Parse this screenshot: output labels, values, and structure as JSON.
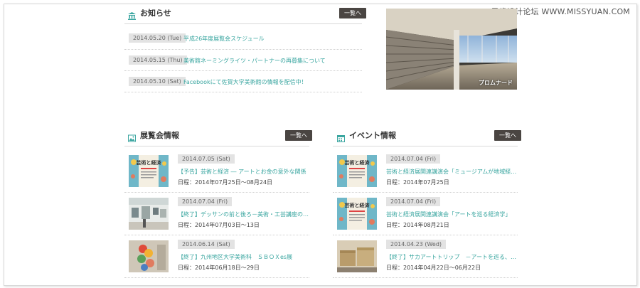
{
  "watermark": "思缘设计论坛 WWW.MISSYUAN.COM",
  "news": {
    "title": "お知らせ",
    "more_label": "一覧へ",
    "items": [
      {
        "date": "2014.05.20 (Tue)",
        "text": "平成26年度展覧会スケジュール"
      },
      {
        "date": "2014.05.15 (Thu)",
        "text": "美術館ネーミングライツ・パートナーの再募集について"
      },
      {
        "date": "2014.05.10 (Sat)",
        "text": "Facebookにて佐賀大学美術館の情報を配信中！"
      }
    ]
  },
  "photo": {
    "caption": "プロムナード"
  },
  "exhibitions": {
    "title": "展覧会情報",
    "more_label": "一覧へ",
    "items": [
      {
        "date": "2014.07.05 (Sat)",
        "title": "【予告】芸術と経済 ― アートとお金の意外な関係",
        "schedule": "日程：2014年07月25日～08月24日",
        "thumb": "poster"
      },
      {
        "date": "2014.07.04 (Fri)",
        "title": "【終了】デッサンの前と後ろ－美術・工芸講座の…",
        "schedule": "日程：2014年07月03日～13日",
        "thumb": "gallery"
      },
      {
        "date": "2014.06.14 (Sat)",
        "title": "【終了】九州地区大学美術科　ＳＢＯＸes展",
        "schedule": "日程：2014年06月18日～29日",
        "thumb": "sculpture"
      }
    ]
  },
  "events": {
    "title": "イベント情報",
    "more_label": "一覧へ",
    "items": [
      {
        "date": "2014.07.04 (Fri)",
        "title": "芸術と経済展関連講演会「ミュージアムが地域経…",
        "schedule": "日程：2014年07月25日",
        "thumb": "poster"
      },
      {
        "date": "2014.07.04 (Fri)",
        "title": "芸術と経済展関連講演会「アートを巡る経済学」",
        "schedule": "日程：2014年08月21日",
        "thumb": "poster"
      },
      {
        "date": "2014.04.23 (Wed)",
        "title": "【終了】サカアートトリップ　－アートを巡る、…",
        "schedule": "日程：2014年04月22日～06月22日",
        "thumb": "boxes"
      }
    ]
  },
  "poster_text": {
    "line1": "芸術と経済"
  },
  "colors": {
    "accent": "#3aa6a0",
    "button": "#4a4542"
  }
}
